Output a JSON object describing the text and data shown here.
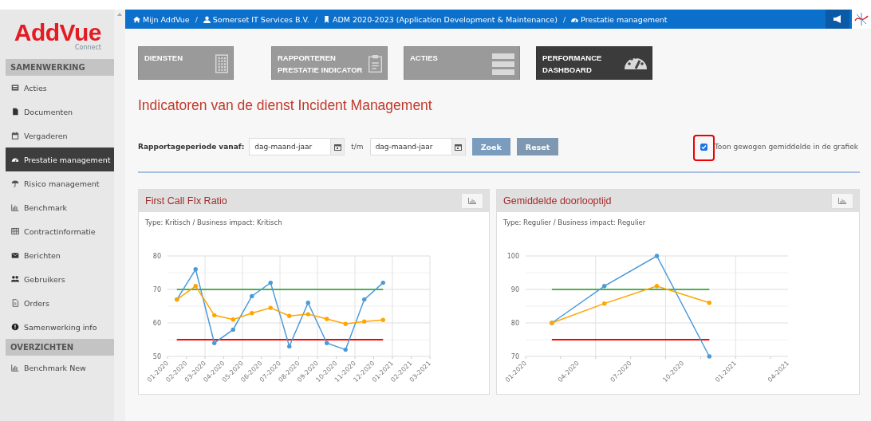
{
  "logo": {
    "name": "AddVue",
    "tagline": "Connect"
  },
  "sidebar": {
    "sections": [
      {
        "title": "SAMENWERKING",
        "items": [
          {
            "label": "Acties",
            "selected": false
          },
          {
            "label": "Documenten",
            "selected": false
          },
          {
            "label": "Vergaderen",
            "selected": false
          },
          {
            "label": "Prestatie management",
            "selected": true
          },
          {
            "label": "Risico management",
            "selected": false
          },
          {
            "label": "Benchmark",
            "selected": false
          },
          {
            "label": "Contractinformatie",
            "selected": false
          },
          {
            "label": "Berichten",
            "selected": false
          },
          {
            "label": "Gebruikers",
            "selected": false
          },
          {
            "label": "Orders",
            "selected": false
          },
          {
            "label": "Samenwerking info",
            "selected": false
          }
        ]
      },
      {
        "title": "OVERZICHTEN",
        "items": [
          {
            "label": "Benchmark New",
            "selected": false
          }
        ]
      }
    ]
  },
  "breadcrumb": [
    "Mijn AddVue",
    "Somerset IT Services B.V.",
    "ADM 2020-2023 (Application Development & Maintenance)",
    "Prestatie management"
  ],
  "breadcrumb_separator": "/",
  "tiles": [
    {
      "label": "DIENSTEN",
      "selected": false
    },
    {
      "label": "RAPPORTEREN PRESTATIE INDICATOR",
      "selected": false
    },
    {
      "label": "ACTIES",
      "selected": false
    },
    {
      "label": "PERFORMANCE DASHBOARD",
      "selected": true
    }
  ],
  "heading": "Indicatoren van de dienst Incident Management",
  "filter": {
    "label": "Rapportageperiode vanaf:",
    "from": {
      "placeholder": "dag-maand-jaar"
    },
    "between": "t/m",
    "to": {
      "placeholder": "dag-maand-jaar"
    },
    "buttons": [
      "Zoek",
      "Reset"
    ],
    "checkbox": {
      "label": "Toon gewogen gemiddelde in de grafiek",
      "checked": true,
      "highlighted": true
    }
  },
  "panels": [
    {
      "title": "First Call FIx Ratio",
      "subtitle": "Type: Kritisch / Business impact: Kritisch",
      "chart_data": {
        "type": "line",
        "grid": true,
        "ylim": [
          50,
          80
        ],
        "yticks": [
          50,
          60,
          70,
          80
        ],
        "categories": [
          "01-2020",
          null,
          "02-2020",
          null,
          "03-2020",
          null,
          "04-2020",
          null,
          "05-2020",
          null,
          "06-2020",
          null,
          "07-2020",
          null,
          "08-2020",
          null,
          "09-2020",
          null,
          "10-2020",
          null,
          "11-2020",
          null,
          "12-2020",
          null,
          "01-2021",
          null,
          "02-2021",
          null,
          "03-2021"
        ],
        "series": [
          {
            "color": "#4caf50",
            "values": [
              null,
              70,
              null,
              70,
              null,
              70,
              null,
              70,
              null,
              70,
              null,
              70,
              null,
              70,
              null,
              70,
              null,
              70,
              null,
              70,
              null,
              70,
              null,
              70,
              null,
              null,
              null,
              null,
              null
            ]
          },
          {
            "color": "#ff0000",
            "values": [
              null,
              55,
              null,
              55,
              null,
              55,
              null,
              55,
              null,
              55,
              null,
              55,
              null,
              55,
              null,
              55,
              null,
              55,
              null,
              55,
              null,
              55,
              null,
              55,
              null,
              null,
              null,
              null,
              null
            ]
          },
          {
            "color": "#4a9ad8",
            "values": [
              null,
              67,
              null,
              76,
              null,
              54,
              null,
              58,
              null,
              68,
              null,
              72,
              null,
              53,
              null,
              66,
              null,
              54,
              null,
              52,
              null,
              67,
              null,
              72,
              null,
              null,
              null,
              null,
              null
            ]
          },
          {
            "color": "#ffa500",
            "values": [
              null,
              67,
              null,
              71,
              null,
              62.3,
              null,
              61,
              null,
              62.9,
              null,
              64.5,
              null,
              62.1,
              null,
              62.6,
              null,
              61.2,
              null,
              59.7,
              null,
              60.4,
              null,
              60.9,
              null,
              null,
              null,
              null,
              null
            ]
          }
        ]
      }
    },
    {
      "title": "Gemiddelde doorlooptijd",
      "subtitle": "Type: Regulier / Business impact: Regulier",
      "chart_data": {
        "type": "line",
        "grid": true,
        "ylim": [
          70,
          100
        ],
        "yticks": [
          70,
          80,
          90,
          100
        ],
        "categories": [
          "01-2020",
          null,
          null,
          null,
          null,
          null,
          "04-2020",
          null,
          null,
          null,
          null,
          null,
          "07-2020",
          null,
          null,
          null,
          null,
          null,
          "10-2020",
          null,
          null,
          null,
          null,
          null,
          "01-2021",
          null,
          null,
          null,
          null,
          null,
          "04-2021"
        ],
        "series": [
          {
            "color": "#4caf50",
            "values": [
              null,
              null,
              null,
              90,
              null,
              null,
              null,
              null,
              null,
              90,
              null,
              null,
              null,
              null,
              null,
              90,
              null,
              null,
              null,
              null,
              null,
              90,
              null,
              null,
              null,
              null,
              null,
              null,
              null,
              null,
              null
            ]
          },
          {
            "color": "#ff0000",
            "values": [
              null,
              null,
              null,
              75,
              null,
              null,
              null,
              null,
              null,
              75,
              null,
              null,
              null,
              null,
              null,
              75,
              null,
              null,
              null,
              null,
              null,
              75,
              null,
              null,
              null,
              null,
              null,
              null,
              null,
              null,
              null
            ]
          },
          {
            "color": "#4a9ad8",
            "values": [
              null,
              null,
              null,
              80,
              null,
              null,
              null,
              null,
              null,
              91,
              null,
              null,
              null,
              null,
              null,
              100,
              null,
              null,
              null,
              null,
              null,
              70,
              null,
              null,
              null,
              null,
              null,
              null,
              null,
              null,
              null
            ]
          },
          {
            "color": "#ffa500",
            "values": [
              null,
              null,
              null,
              80,
              null,
              null,
              null,
              null,
              null,
              85.8,
              null,
              null,
              null,
              null,
              null,
              91,
              null,
              null,
              null,
              null,
              null,
              86,
              null,
              null,
              null,
              null,
              null,
              null,
              null,
              null,
              null
            ]
          }
        ]
      }
    }
  ]
}
